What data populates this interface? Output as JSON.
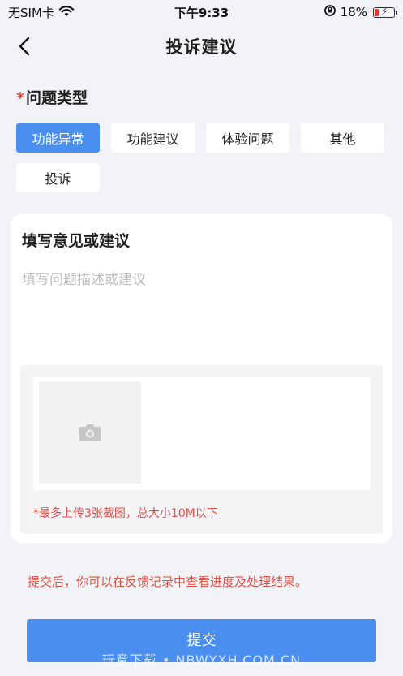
{
  "status_bar": {
    "carrier": "无SIM卡",
    "time": "下午9:33",
    "battery": "18%"
  },
  "nav": {
    "title": "投诉建议"
  },
  "issue_type": {
    "required_mark": "*",
    "label": "问题类型",
    "options": [
      "功能异常",
      "功能建议",
      "体验问题",
      "其他",
      "投诉"
    ],
    "selected": "功能异常"
  },
  "feedback": {
    "title": "填写意见或建议",
    "placeholder": "填写问题描述或建议",
    "upload_hint": "*最多上传3张截图，总大小10M以下"
  },
  "submit_note": "提交后，你可以在反馈记录中查看进度及处理结果。",
  "submit_label": "提交",
  "watermark": "玩意下载 • NBWYXH.COM.CN",
  "colors": {
    "accent": "#4a8ff0",
    "warning": "#d9534a",
    "background": "#f2f3f7"
  }
}
